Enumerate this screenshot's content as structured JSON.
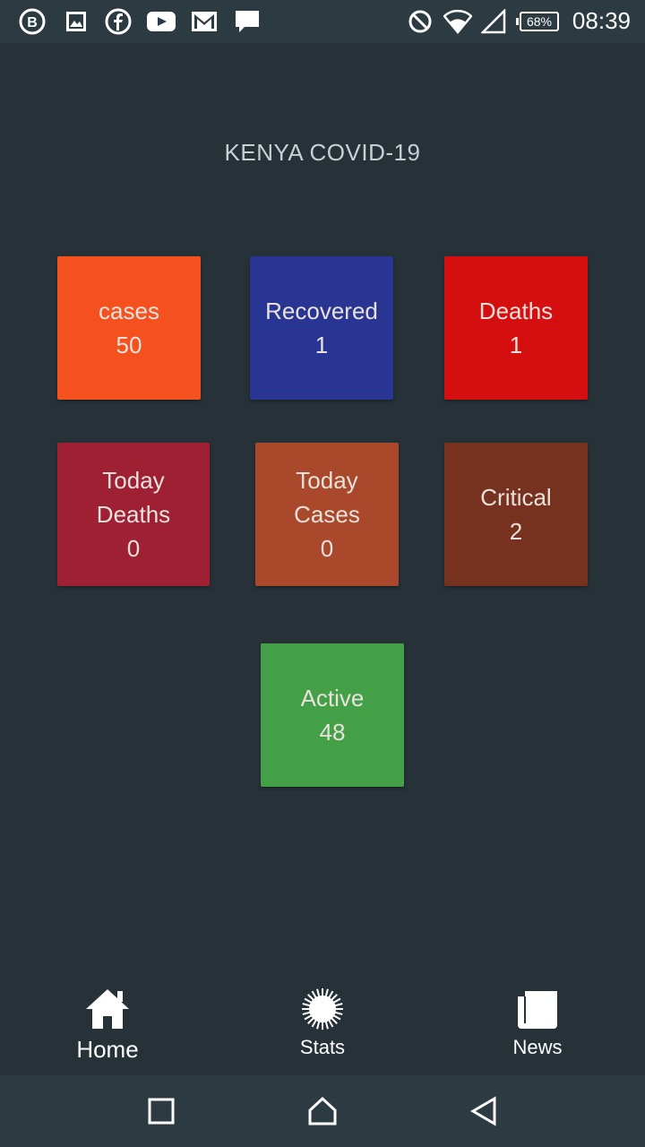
{
  "status_bar": {
    "icons": [
      "bbm-icon",
      "image-icon",
      "facebook-icon",
      "youtube-icon",
      "gmail-icon",
      "message-icon"
    ],
    "right_icons": [
      "do-not-disturb-icon",
      "wifi-icon",
      "signal-icon"
    ],
    "battery": "68%",
    "time": "08:39"
  },
  "title": "KENYA COVID-19",
  "tiles": {
    "cases": {
      "label": "cases",
      "value": "50",
      "color": "#f4511e"
    },
    "recovered": {
      "label": "Recovered",
      "value": "1",
      "color": "#283593"
    },
    "deaths": {
      "label": "Deaths",
      "value": "1",
      "color": "#d50f0f"
    },
    "today_deaths": {
      "label": "Today Deaths",
      "value": "0",
      "color": "#9e2032"
    },
    "today_cases": {
      "label": "Today Cases",
      "value": "0",
      "color": "#a9482a"
    },
    "critical": {
      "label": "Critical",
      "value": "2",
      "color": "#76311f"
    },
    "active": {
      "label": "Active",
      "value": "48",
      "color": "#43a047"
    }
  },
  "bottom_nav": {
    "home": "Home",
    "stats": "Stats",
    "news": "News"
  },
  "system_nav": [
    "recents-icon",
    "home-icon",
    "back-icon"
  ]
}
